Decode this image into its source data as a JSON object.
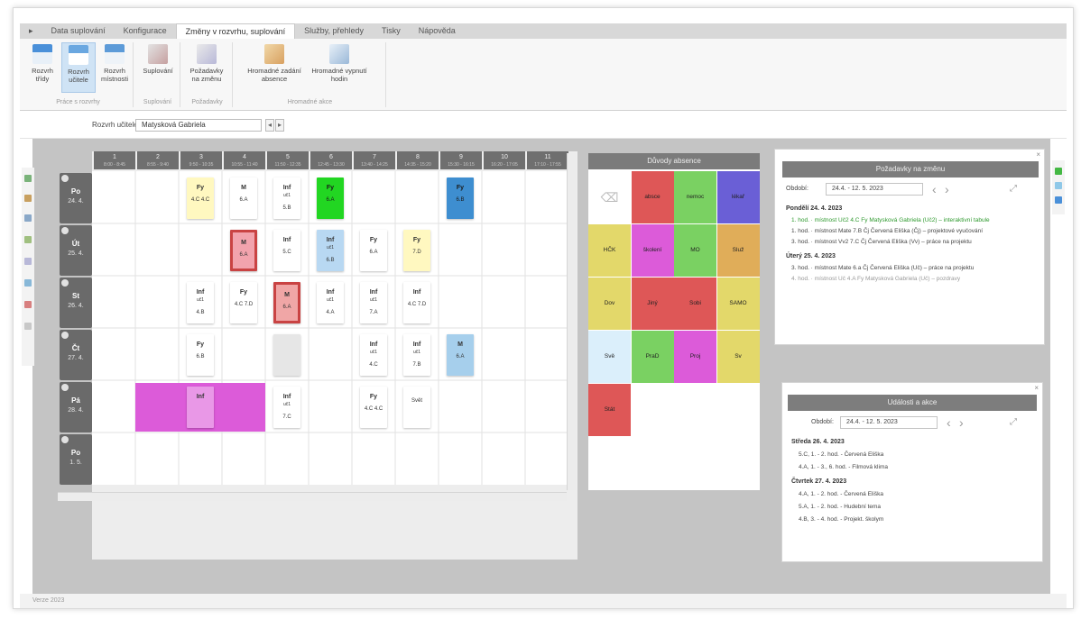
{
  "ribbon": {
    "tabs": [
      {
        "label": "▸",
        "active": false
      },
      {
        "label": "Data suplování",
        "active": false
      },
      {
        "label": "Konfigurace",
        "active": false
      },
      {
        "label": "Změny v rozvrhu, suplování",
        "active": true
      },
      {
        "label": "Služby, přehledy",
        "active": false
      },
      {
        "label": "Tisky",
        "active": false
      },
      {
        "label": "Nápověda",
        "active": false
      }
    ],
    "groups": [
      {
        "caption": "Práce s rozvrhy",
        "buttons": [
          "Rozvrh třídy",
          "Rozvrh učitele",
          "Rozvrh místnosti"
        ]
      },
      {
        "caption": "Suplování",
        "buttons": [
          "Suplování"
        ]
      },
      {
        "caption": "Požadavky",
        "buttons": [
          "Požadavky na změnu"
        ]
      },
      {
        "caption": "Hromadné akce",
        "buttons": [
          "Hromadné zadání absence",
          "Hromadné vypnutí hodin"
        ]
      }
    ]
  },
  "teacher_selector": {
    "label": "Rozvrh učitele:",
    "value": "Matysková Gabriela",
    "nav_prev": "◂",
    "nav_next": "▸"
  },
  "timetable": {
    "periods": [
      {
        "num": "1",
        "time": "8:00 - 8:45"
      },
      {
        "num": "2",
        "time": "8:55 - 9:40"
      },
      {
        "num": "3",
        "time": "9:50 - 10:35"
      },
      {
        "num": "4",
        "time": "10:55 - 11:40"
      },
      {
        "num": "5",
        "time": "11:50 - 12:35"
      },
      {
        "num": "6",
        "time": "12:45 - 13:30"
      },
      {
        "num": "7",
        "time": "13:40 - 14:25"
      },
      {
        "num": "8",
        "time": "14:35 - 15:20"
      },
      {
        "num": "9",
        "time": "15:30 - 16:15"
      },
      {
        "num": "10",
        "time": "16:20 - 17:05"
      },
      {
        "num": "11",
        "time": "17:10 - 17:55"
      }
    ],
    "days": [
      {
        "name": "Po",
        "date": "24. 4."
      },
      {
        "name": "Út",
        "date": "25. 4."
      },
      {
        "name": "St",
        "date": "26. 4."
      },
      {
        "name": "Čt",
        "date": "27. 4."
      },
      {
        "name": "Pá",
        "date": "28. 4."
      },
      {
        "name": "Po",
        "date": "1. 5."
      }
    ],
    "lessons": [
      {
        "subject": "Fy",
        "room": "",
        "class": "4.C 4.C",
        "color": "#fff8c0"
      },
      {
        "subject": "M",
        "room": "",
        "class": "6.A",
        "color": "#ffffff"
      },
      {
        "subject": "Inf",
        "room": "uč1",
        "class": "5.B",
        "color": "#ffffff"
      },
      {
        "subject": "Fy",
        "room": "",
        "class": "6.A",
        "color": "#22d622"
      },
      {
        "subject": "Fy",
        "room": "",
        "class": "6.B",
        "color": "#3e8ed0"
      },
      {
        "subject": "M",
        "room": "",
        "class": "6.A",
        "color": "#f2a3ad"
      },
      {
        "subject": "Inf",
        "room": "",
        "class": "5.C",
        "color": "#ffffff"
      },
      {
        "subject": "Inf",
        "room": "uč1",
        "class": "6.B",
        "color": "#b8d8f2"
      },
      {
        "subject": "Fy",
        "room": "",
        "class": "6.A",
        "color": "#ffffff"
      },
      {
        "subject": "Fy",
        "room": "",
        "class": "7.D",
        "color": "#fff8c0"
      },
      {
        "subject": "Inf",
        "room": "uč1",
        "class": "4.B",
        "color": "#ffffff"
      },
      {
        "subject": "Fy",
        "room": "",
        "class": "4.C 7.D",
        "color": "#ffffff"
      },
      {
        "subject": "M",
        "room": "",
        "class": "6.A",
        "color": "#f0a6a6"
      },
      {
        "subject": "Inf",
        "room": "uč1",
        "class": "4.A",
        "color": "#ffffff"
      },
      {
        "subject": "Inf",
        "room": "uč1",
        "class": "7.A",
        "color": "#ffffff"
      },
      {
        "subject": "Inf",
        "room": "",
        "class": "4.C 7.D",
        "color": "#ffffff"
      },
      {
        "subject": "Fy",
        "room": "",
        "class": "6.B",
        "color": "#ffffff"
      },
      {
        "subject": "",
        "room": "",
        "class": "",
        "color": "#e6e6e6"
      },
      {
        "subject": "Inf",
        "room": "uč1",
        "class": "4.C",
        "color": "#ffffff"
      },
      {
        "subject": "Inf",
        "room": "uč1",
        "class": "7.B",
        "color": "#ffffff"
      },
      {
        "subject": "M",
        "room": "",
        "class": "6.A",
        "color": "#a6cfec"
      },
      {
        "subject": "Inf",
        "room": "",
        "class": "",
        "color": "#e998e7"
      },
      {
        "subject": "Inf",
        "room": "uč1",
        "class": "7.C",
        "color": "#ffffff"
      },
      {
        "subject": "Fy",
        "room": "",
        "class": "4.C 4.C",
        "color": "#ffffff"
      },
      {
        "subject": "",
        "room": "",
        "class": "Svět",
        "color": "#ffffff"
      }
    ]
  },
  "absence_overview": {
    "title": "Důvody absence",
    "eraser_icon": "eraser-icon",
    "items": [
      {
        "label": "",
        "color": "#ffffff"
      },
      {
        "label": "absce",
        "color": "#de5757"
      },
      {
        "label": "nemoc",
        "color": "#7ad162"
      },
      {
        "label": "lékař",
        "color": "#6a5fd6"
      },
      {
        "label": "HČK",
        "color": "#e3d86a"
      },
      {
        "label": "školení",
        "color": "#dc5bd9"
      },
      {
        "label": "MO",
        "color": "#7ad162"
      },
      {
        "label": "Služ",
        "color": "#e0ad59"
      },
      {
        "label": "Dov",
        "color": "#e3d86a"
      },
      {
        "label": "Jiný",
        "color": "#de5757"
      },
      {
        "label": "Sobi",
        "color": "#de5757"
      },
      {
        "label": "SAMO",
        "color": "#e3d86a"
      },
      {
        "label": "Svě",
        "color": "#dbeffb"
      },
      {
        "label": "PraD",
        "color": "#7ad162"
      },
      {
        "label": "Proj",
        "color": "#dc5bd9"
      },
      {
        "label": "Sv",
        "color": "#e3d86a"
      },
      {
        "label": "Stát",
        "color": "#de5757"
      }
    ]
  },
  "requests_panel": {
    "title": "Požadavky na změnu",
    "week_label": "Období:",
    "range": "24.4. - 12. 5. 2023",
    "days": [
      {
        "heading": "Pondělí 24. 4. 2023",
        "items": [
          {
            "text": "1. hod. · místnost Uč2 4.C Fy Matysková Gabriela (Uč2) – interaktivní tabule",
            "color": "#2f9a2f"
          },
          {
            "text": "1. hod. · místnost Mate 7.B Čj Červená Eliška (Čj) – projektové vyučování",
            "color": "#444444"
          },
          {
            "text": "3. hod. · místnost Vv2 7.C Čj Červená Eliška (Vv) – práce na projektu",
            "color": "#444444"
          }
        ]
      },
      {
        "heading": "Úterý 25. 4. 2023",
        "items": [
          {
            "text": "3. hod. · místnost Mate 6.a Čj Červená Eliška (Uč) – práce na projektu",
            "color": "#444444"
          },
          {
            "text": "4. hod. · místnost Uč 4.A Fy Matysková Gabriela (Uč) – pozdravy",
            "color": "#999999"
          }
        ]
      }
    ]
  },
  "events_panel": {
    "title": "Události a akce",
    "week_label": "Období:",
    "range": "24.4. - 12. 5. 2023",
    "days": [
      {
        "heading": "Středa 26. 4. 2023",
        "items": [
          "5.C, 1. - 2. hod. - Červená Eliška",
          "4.A, 1. - 3., 6. hod. - Filmová klima"
        ]
      },
      {
        "heading": "Čtvrtek 27. 4. 2023",
        "items": [
          "4.A, 1. - 2. hod. - Červená Eliška",
          "5.A, 1. - 2. hod. - Hudební tema",
          "4.B, 3. - 4. hod. - Projekt. školym"
        ]
      }
    ]
  },
  "status_text": "Verze 2023"
}
